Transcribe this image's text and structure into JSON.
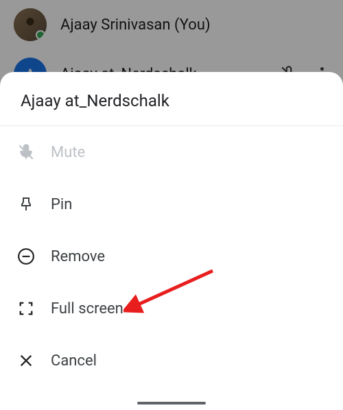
{
  "participants": [
    {
      "name": "Ajaay Srinivasan (You)",
      "initial": "",
      "has_image": true,
      "online": true
    },
    {
      "name": "Ajaay at_Nerdschalk",
      "initial": "A",
      "has_image": false,
      "online": false
    }
  ],
  "sheet": {
    "title": "Ajaay at_Nerdschalk",
    "items": [
      {
        "label": "Mute",
        "icon": "mute-icon",
        "disabled": true
      },
      {
        "label": "Pin",
        "icon": "pin-icon",
        "disabled": false
      },
      {
        "label": "Remove",
        "icon": "remove-icon",
        "disabled": false
      },
      {
        "label": "Full screen",
        "icon": "fullscreen-icon",
        "disabled": false
      },
      {
        "label": "Cancel",
        "icon": "cancel-icon",
        "disabled": false
      }
    ]
  }
}
